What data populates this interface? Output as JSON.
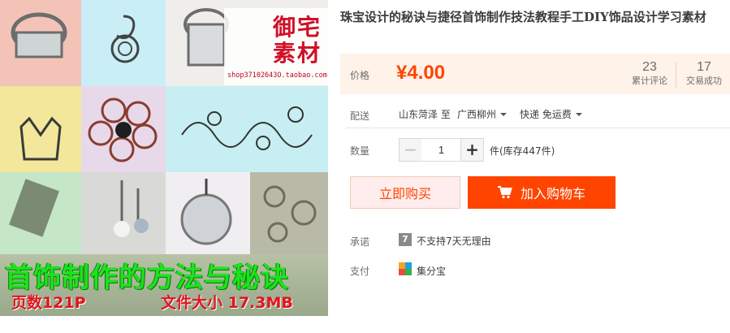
{
  "product": {
    "title": "珠宝设计的秘诀与捷径首饰制作技法教程手工DIY饰品设计学习素材",
    "image": {
      "caption": "首饰制作的方法与秘诀",
      "pages_text": "页数121P",
      "size_text": "文件大小 17.3MB",
      "stamp_text": "御宅素材",
      "stamp_url": "shop37102643O.taobao.com"
    }
  },
  "price": {
    "label": "价格",
    "value": "¥4.00"
  },
  "stats": {
    "reviews_count": "23",
    "reviews_label": "累计评论",
    "sales_count": "17",
    "sales_label": "交易成功"
  },
  "delivery": {
    "label": "配送",
    "from": "山东菏泽 至",
    "to": "广西柳州",
    "method": "快递 免运费"
  },
  "quantity": {
    "label": "数量",
    "minus": "−",
    "value": "1",
    "plus": "+",
    "stock": "件(库存447件)"
  },
  "actions": {
    "buy_now": "立即购买",
    "add_to_cart": "加入购物车"
  },
  "promise": {
    "label": "承诺",
    "badge": "7",
    "text": "不支持7天无理由"
  },
  "payment": {
    "label": "支付",
    "method": "集分宝"
  },
  "colors": {
    "accent": "#ff4400",
    "price_bg": "#fff2e8",
    "buy_now_bg": "#ffeded"
  },
  "icons": [
    "cart-icon",
    "caret-down-icon",
    "seven-day-icon",
    "jifenbao-icon"
  ]
}
